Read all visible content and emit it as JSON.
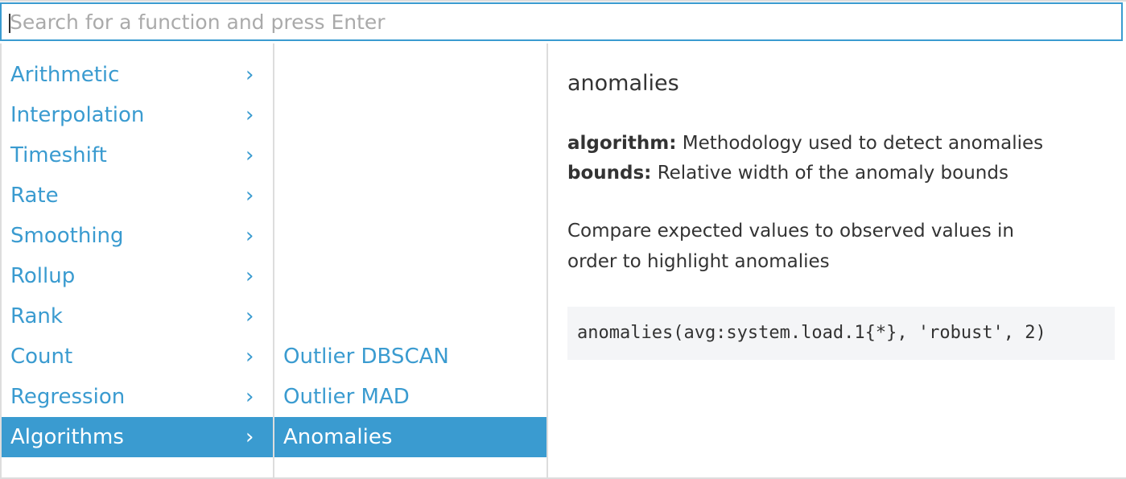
{
  "search": {
    "placeholder": "Search for a function and press Enter",
    "value": ""
  },
  "categories": [
    {
      "label": "Arithmetic",
      "chevron": "›"
    },
    {
      "label": "Interpolation",
      "chevron": "›"
    },
    {
      "label": "Timeshift",
      "chevron": "›"
    },
    {
      "label": "Rate",
      "chevron": "›"
    },
    {
      "label": "Smoothing",
      "chevron": "›"
    },
    {
      "label": "Rollup",
      "chevron": "›"
    },
    {
      "label": "Rank",
      "chevron": "›"
    },
    {
      "label": "Count",
      "chevron": "›"
    },
    {
      "label": "Regression",
      "chevron": "›"
    },
    {
      "label": "Algorithms",
      "chevron": "›"
    }
  ],
  "selected_category": "Algorithms",
  "functions": [
    {
      "label": "Outlier DBSCAN"
    },
    {
      "label": "Outlier MAD"
    },
    {
      "label": "Anomalies"
    }
  ],
  "selected_function": "Anomalies",
  "detail": {
    "title": "anomalies",
    "params": [
      {
        "name": "algorithm:",
        "description": "Methodology used to detect anomalies"
      },
      {
        "name": "bounds:",
        "description": "Relative width of the anomaly bounds"
      }
    ],
    "description": "Compare expected values to observed values in order to highlight anomalies",
    "example": "anomalies(avg:system.load.1{*}, 'robust', 2)"
  },
  "colors": {
    "accent": "#3a9bd0",
    "text": "#333333",
    "placeholder": "#aaaaaa",
    "border": "#dddddd",
    "code_bg": "#f4f5f7"
  }
}
